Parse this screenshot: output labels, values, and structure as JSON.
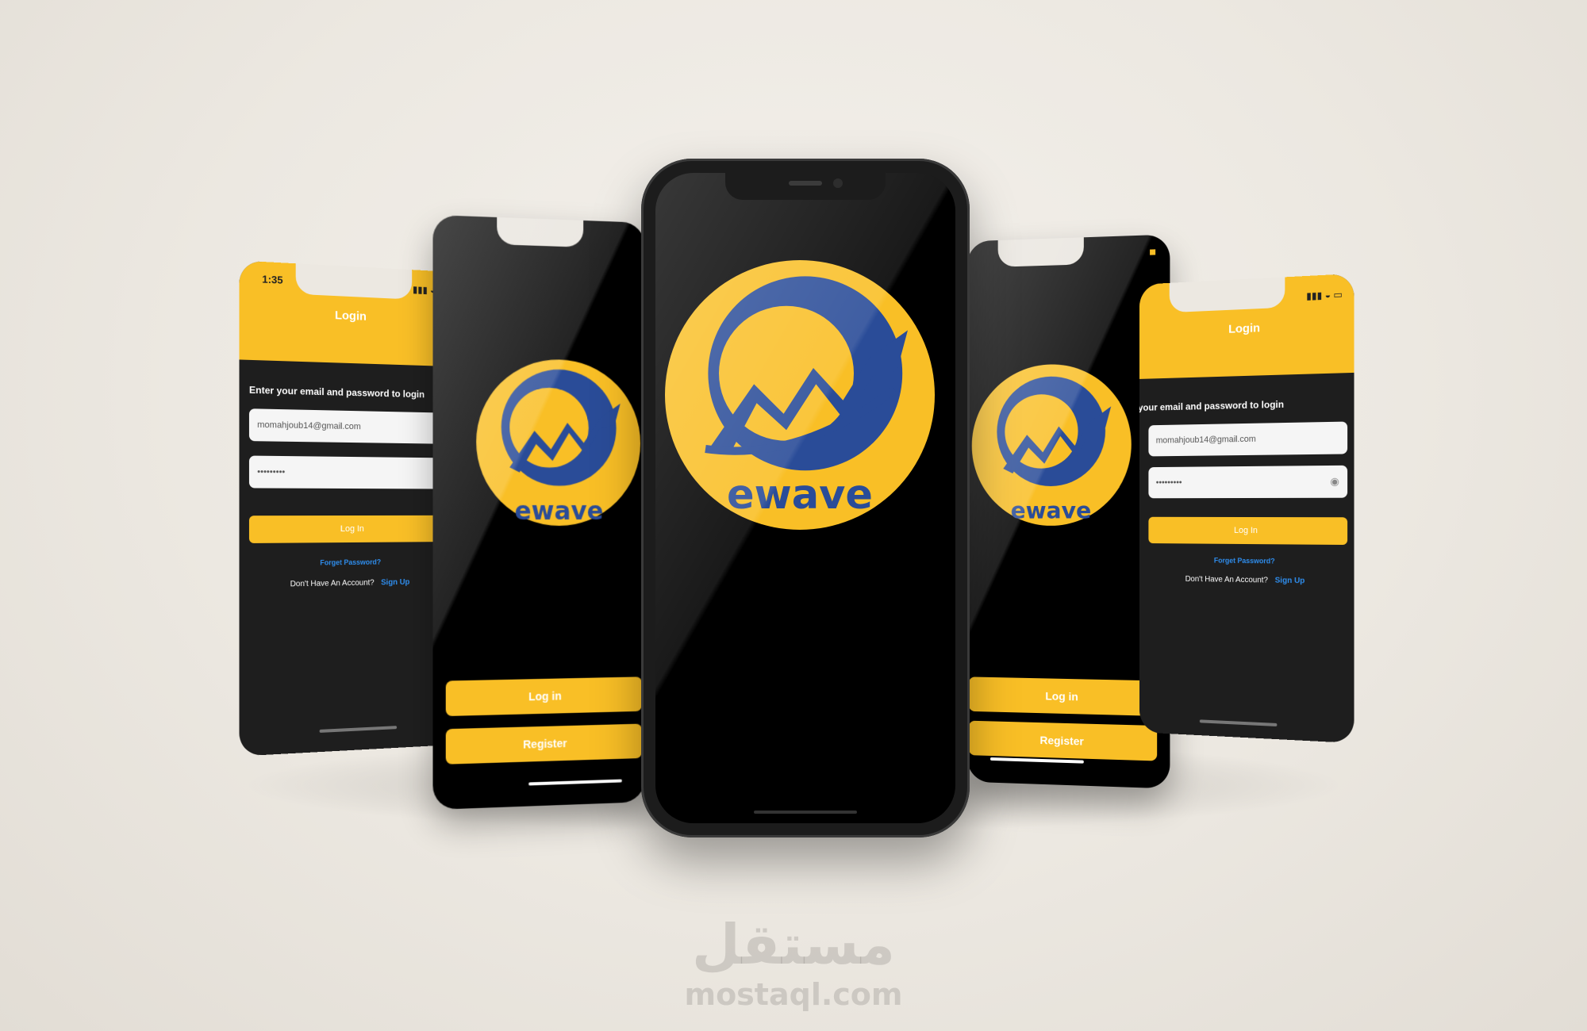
{
  "brand": {
    "name": "ewave",
    "colors": {
      "yellow": "#f9bf26",
      "navy": "#2a4c98",
      "dark": "#1e1e1e"
    }
  },
  "login_screen": {
    "time": "1:35",
    "title": "Login",
    "subtitle": "Enter your email and password to login",
    "email_value": "momahjoub14@gmail.com",
    "password_value": "•••••••••",
    "login_button": "Log In",
    "forgot_link": "Forget Password?",
    "no_account_text": "Don't Have An Account?",
    "signup_link": "Sign Up"
  },
  "splash_screen": {
    "login_button": "Log in",
    "register_button": "Register"
  },
  "watermark": {
    "arabic": "مستقل",
    "latin": "mostaql.com"
  }
}
